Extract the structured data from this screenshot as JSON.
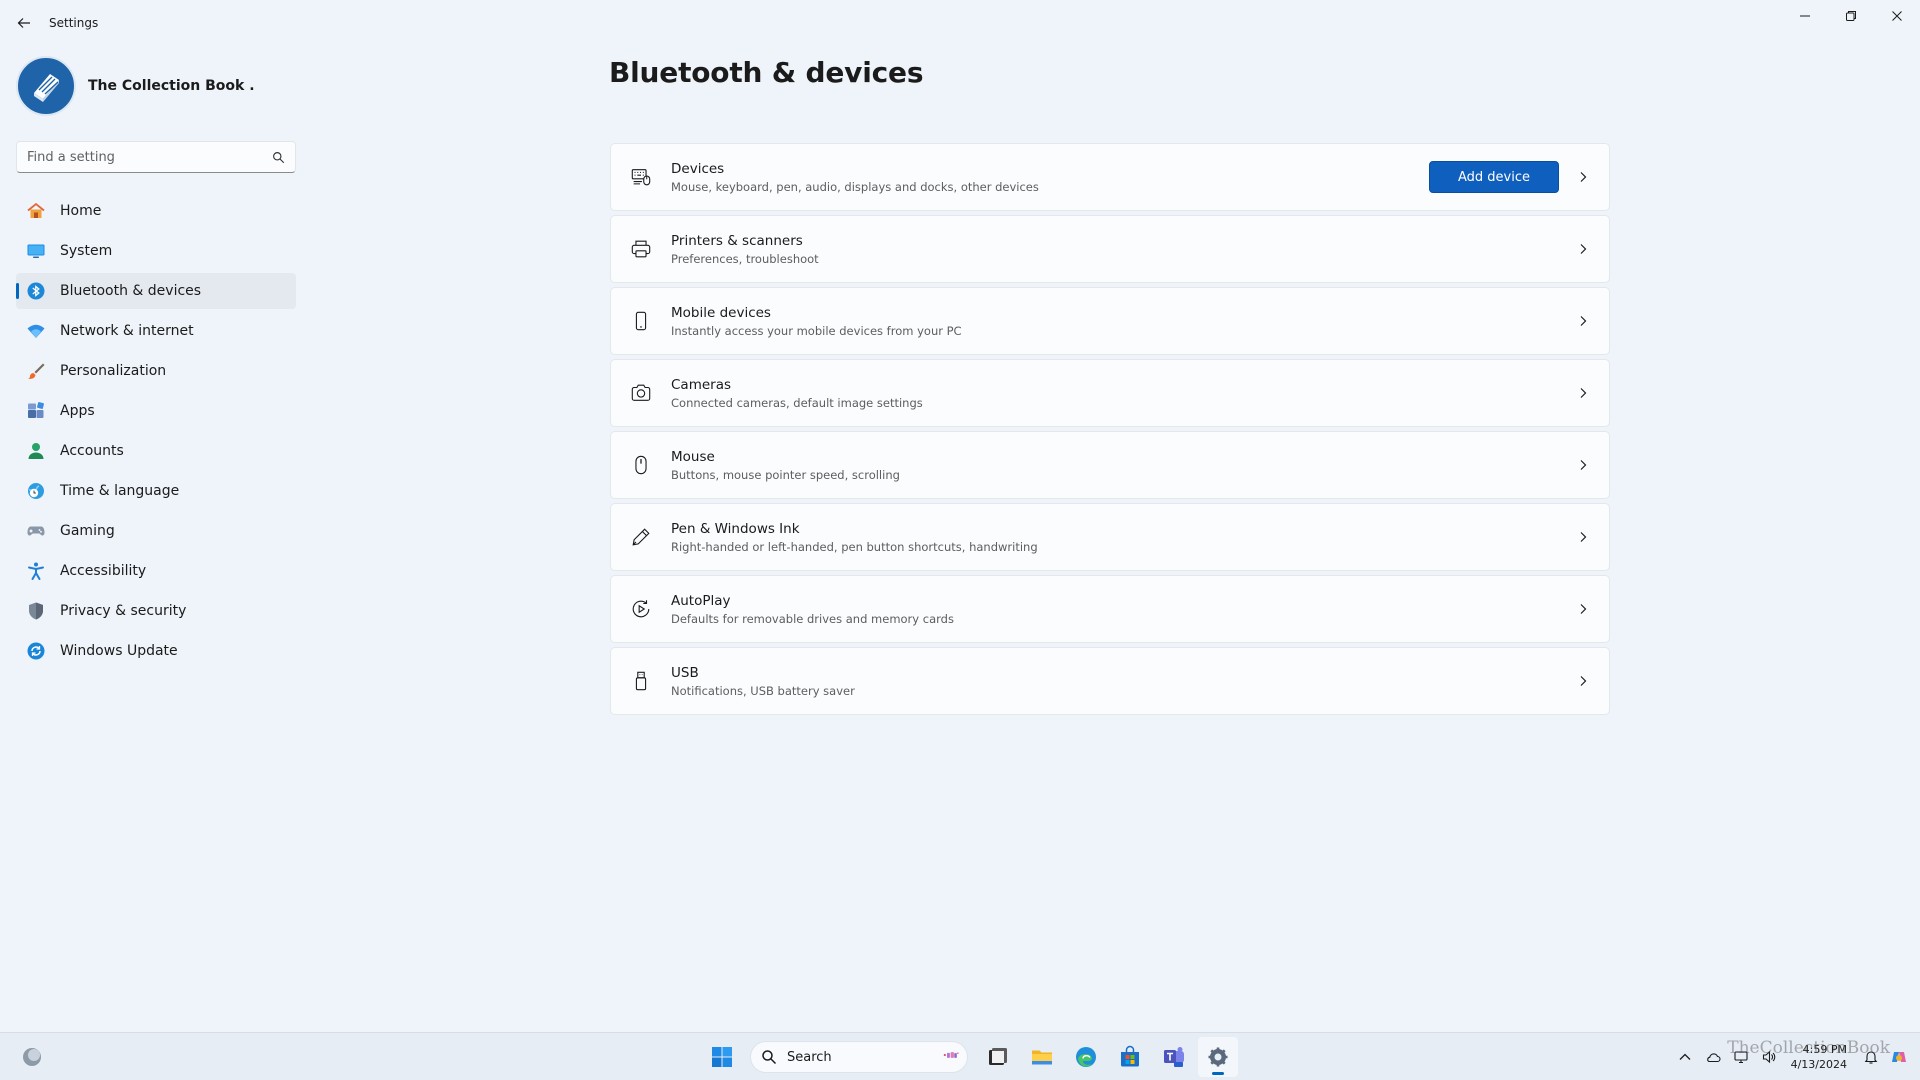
{
  "window": {
    "app_title": "Settings"
  },
  "profile": {
    "name": "The Collection Book ."
  },
  "search": {
    "placeholder": "Find a setting"
  },
  "nav": [
    {
      "label": "Home",
      "icon": "home-icon",
      "active": false
    },
    {
      "label": "System",
      "icon": "monitor-icon",
      "active": false
    },
    {
      "label": "Bluetooth & devices",
      "icon": "bluetooth-icon",
      "active": true
    },
    {
      "label": "Network & internet",
      "icon": "wifi-icon",
      "active": false
    },
    {
      "label": "Personalization",
      "icon": "brush-icon",
      "active": false
    },
    {
      "label": "Apps",
      "icon": "apps-icon",
      "active": false
    },
    {
      "label": "Accounts",
      "icon": "person-icon",
      "active": false
    },
    {
      "label": "Time & language",
      "icon": "globe-clock-icon",
      "active": false
    },
    {
      "label": "Gaming",
      "icon": "gamepad-icon",
      "active": false
    },
    {
      "label": "Accessibility",
      "icon": "accessibility-icon",
      "active": false
    },
    {
      "label": "Privacy & security",
      "icon": "shield-icon",
      "active": false
    },
    {
      "label": "Windows Update",
      "icon": "update-icon",
      "active": false
    }
  ],
  "main": {
    "title": "Bluetooth & devices",
    "add_device_label": "Add device",
    "cards": [
      {
        "title": "Devices",
        "subtitle": "Mouse, keyboard, pen, audio, displays and docks, other devices",
        "icon": "devices-icon"
      },
      {
        "title": "Printers & scanners",
        "subtitle": "Preferences, troubleshoot",
        "icon": "printer-icon"
      },
      {
        "title": "Mobile devices",
        "subtitle": "Instantly access your mobile devices from your PC",
        "icon": "phone-icon"
      },
      {
        "title": "Cameras",
        "subtitle": "Connected cameras, default image settings",
        "icon": "camera-icon"
      },
      {
        "title": "Mouse",
        "subtitle": "Buttons, mouse pointer speed, scrolling",
        "icon": "mouse-icon"
      },
      {
        "title": "Pen & Windows Ink",
        "subtitle": "Right-handed or left-handed, pen button shortcuts, handwriting",
        "icon": "pen-icon"
      },
      {
        "title": "AutoPlay",
        "subtitle": "Defaults for removable drives and memory cards",
        "icon": "autoplay-icon"
      },
      {
        "title": "USB",
        "subtitle": "Notifications, USB battery saver",
        "icon": "usb-icon"
      }
    ]
  },
  "taskbar": {
    "search_label": "Search",
    "time": "4:59 PM",
    "date": "4/13/2024",
    "watermark": "TheCollectionBook"
  },
  "colors": {
    "accent": "#0067c0",
    "button": "#0f5fbf",
    "background": "#eff4fa"
  }
}
